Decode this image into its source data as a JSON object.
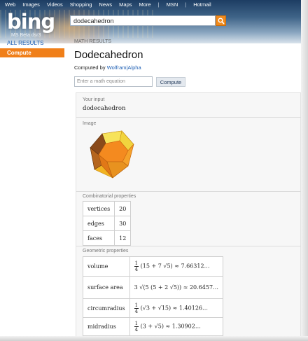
{
  "topnav": {
    "links": [
      "Web",
      "Images",
      "Videos",
      "Shopping",
      "News",
      "Maps",
      "More"
    ],
    "right_links": [
      "MSN",
      "Hotmail"
    ]
  },
  "brand": {
    "logo": "bing",
    "beta": "MS Beta dsr3"
  },
  "search": {
    "value": "dodecahedron"
  },
  "sidebar": {
    "all_results": "ALL RESULTS",
    "active": "Compute"
  },
  "main": {
    "breadcrumb": "MATH RESULTS",
    "title": "Dodecahedron",
    "computed_by_prefix": "Computed by",
    "computed_by_link": "Wolfram|Alpha",
    "equation_placeholder": "Enter a math equation",
    "compute_button": "Compute"
  },
  "results": {
    "input": {
      "label": "Your input",
      "value": "dodecahedron"
    },
    "image": {
      "label": "Image"
    },
    "combinatorial": {
      "label": "Combinatorial properties",
      "rows": [
        {
          "name": "vertices",
          "value": "20"
        },
        {
          "name": "edges",
          "value": "30"
        },
        {
          "name": "faces",
          "value": "12"
        }
      ]
    },
    "geometric": {
      "label": "Geometric properties",
      "rows": [
        {
          "name": "volume",
          "frac_num": "1",
          "frac_den": "4",
          "expr": "(15 + 7 √5) ≈ 7.66312…"
        },
        {
          "name": "surface area",
          "frac_num": "",
          "frac_den": "",
          "expr": "3 √(5 (5 + 2 √5)) ≈ 20.6457…"
        },
        {
          "name": "circumradius",
          "frac_num": "1",
          "frac_den": "4",
          "expr": "(√3 + √15) ≈ 1.40126…"
        },
        {
          "name": "midradius",
          "frac_num": "1",
          "frac_den": "4",
          "expr": "(3 + √5) ≈ 1.30902…"
        }
      ]
    }
  },
  "colors": {
    "accent": "#f07f19",
    "link": "#1e5fb4"
  }
}
